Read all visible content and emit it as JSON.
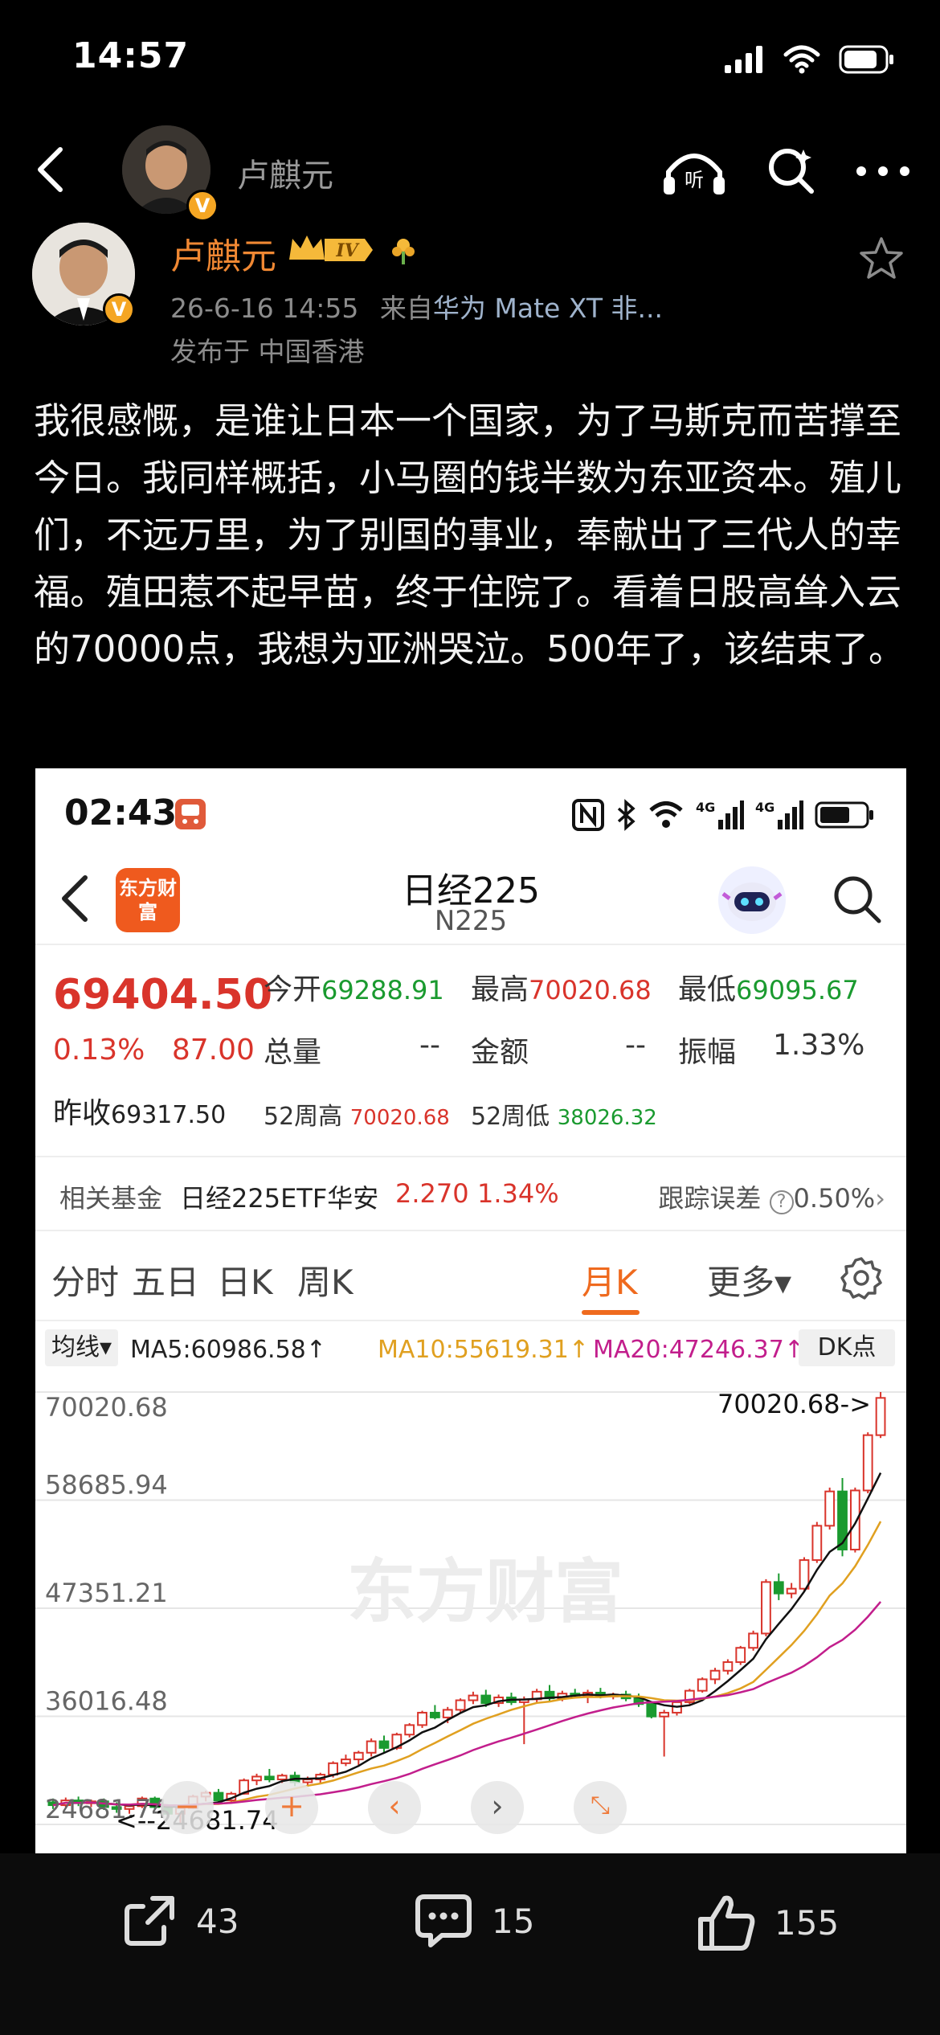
{
  "status_bar": {
    "time": "14:57"
  },
  "nav": {
    "name": "卢麒元"
  },
  "author": {
    "name": "卢麒元",
    "level": "IV",
    "timestamp": "26-6-16 14:55",
    "source_prefix": "来自",
    "device": "华为 Mate XT 非...",
    "location": "发布于 中国香港"
  },
  "post": {
    "text": "我很感慨，是谁让日本一个国家，为了马斯克而苦撑至今日。我同样概括，小马圈的钱半数为东亚资本。殖儿们，不远万里，为了别国的事业，奉献出了三代人的幸福。殖田惹不起早苗，终于住院了。看着日股高耸入云的70000点，我想为亚洲哭泣。500年了，该结束了。"
  },
  "embed": {
    "status_time": "02:43",
    "logo_text": "东方财富",
    "title": "日经225",
    "subtitle": "N225",
    "quote": {
      "price": "69404.50",
      "change_pct": "0.13%",
      "change": "87.00",
      "prev_label": "昨收",
      "prev_value": "69317.50",
      "open_label": "今开",
      "open_value": "69288.91",
      "high_label": "最高",
      "high_value": "70020.68",
      "low_label": "最低",
      "low_value": "69095.67",
      "vol_label": "总量",
      "vol_value": "--",
      "amt_label": "金额",
      "amt_value": "--",
      "amp_label": "振幅",
      "amp_value": "1.33%",
      "w52h_label": "52周高",
      "w52h_value": "70020.68",
      "w52l_label": "52周低",
      "w52l_value": "38026.32"
    },
    "fund": {
      "label": "相关基金",
      "name": "日经225ETF华安",
      "price": "2.270",
      "pct": "1.34%",
      "tracking_label": "跟踪误差",
      "tracking_value": "0.50%"
    },
    "tabs": [
      "分时",
      "五日",
      "日K",
      "周K",
      "月K",
      "更多▾"
    ],
    "ma": {
      "selector": "均线▾",
      "ma5": "MA5:60986.58↑",
      "ma10": "MA10:55619.31↑",
      "ma20": "MA20:47246.37↑",
      "dk": "DK点"
    },
    "watermark": "东方财富",
    "colors": {
      "up": "#d9342b",
      "down": "#1a9a2f",
      "ma5": "#111111",
      "ma10": "#e0a020",
      "ma20": "#c21e8c"
    }
  },
  "chart_data": {
    "type": "candlestick",
    "y_ticks": [
      "70020.68",
      "58685.94",
      "47351.21",
      "36016.48",
      "24681.74"
    ],
    "max_label": "70020.68->",
    "min_label": "<--24681.74",
    "ylim": [
      24681.74,
      70020.68
    ],
    "candles": [
      [
        27000,
        27400,
        26300,
        26700
      ],
      [
        26700,
        27500,
        26500,
        27200
      ],
      [
        27200,
        27600,
        26600,
        26900
      ],
      [
        26900,
        27300,
        26500,
        27100
      ],
      [
        27100,
        27400,
        26200,
        26500
      ],
      [
        26500,
        27000,
        25900,
        26300
      ],
      [
        26300,
        26800,
        25800,
        26600
      ],
      [
        26600,
        27600,
        26400,
        27400
      ],
      [
        27400,
        27600,
        26200,
        26500
      ],
      [
        26500,
        26800,
        25400,
        25800
      ],
      [
        25800,
        26700,
        24682,
        26400
      ],
      [
        26400,
        27800,
        26300,
        27600
      ],
      [
        27600,
        28200,
        27100,
        28000
      ],
      [
        28000,
        28400,
        27000,
        27200
      ],
      [
        27200,
        28100,
        27000,
        27900
      ],
      [
        27900,
        29500,
        27800,
        29300
      ],
      [
        29300,
        30000,
        28800,
        29700
      ],
      [
        29700,
        30500,
        29100,
        29400
      ],
      [
        29400,
        30000,
        29000,
        29800
      ],
      [
        29800,
        30200,
        28700,
        29100
      ],
      [
        29100,
        29700,
        28700,
        29400
      ],
      [
        29400,
        30100,
        29000,
        29900
      ],
      [
        29900,
        31300,
        29600,
        31100
      ],
      [
        31100,
        32000,
        30800,
        31500
      ],
      [
        31500,
        32400,
        30900,
        32200
      ],
      [
        32200,
        33700,
        31800,
        33400
      ],
      [
        33400,
        34000,
        32200,
        32700
      ],
      [
        32700,
        34300,
        32500,
        34100
      ],
      [
        34100,
        35300,
        33800,
        35100
      ],
      [
        35100,
        36600,
        34800,
        36400
      ],
      [
        36400,
        37200,
        35700,
        35900
      ],
      [
        35900,
        37000,
        35300,
        36700
      ],
      [
        36700,
        37900,
        36400,
        37700
      ],
      [
        37700,
        38600,
        37300,
        38200
      ],
      [
        38200,
        38800,
        37000,
        37400
      ],
      [
        37400,
        38300,
        37000,
        38000
      ],
      [
        38000,
        38500,
        37200,
        37500
      ],
      [
        37500,
        38100,
        33100,
        37800
      ],
      [
        37800,
        38900,
        37400,
        38600
      ],
      [
        38600,
        39300,
        37600,
        37900
      ],
      [
        37900,
        38700,
        37600,
        38400
      ],
      [
        38400,
        38900,
        37900,
        38200
      ],
      [
        38200,
        38800,
        37400,
        38500
      ],
      [
        38500,
        39000,
        37900,
        38100
      ],
      [
        38100,
        38500,
        37800,
        38300
      ],
      [
        38300,
        38700,
        37600,
        37900
      ],
      [
        37900,
        38400,
        37000,
        37300
      ],
      [
        37300,
        37600,
        35800,
        36000
      ],
      [
        36000,
        36700,
        31800,
        36400
      ],
      [
        36400,
        37700,
        36100,
        37500
      ],
      [
        37500,
        38900,
        37300,
        38700
      ],
      [
        38700,
        40100,
        38500,
        39900
      ],
      [
        39900,
        41100,
        39400,
        40800
      ],
      [
        40800,
        42000,
        40400,
        41700
      ],
      [
        41700,
        43400,
        41400,
        43200
      ],
      [
        43200,
        45000,
        42900,
        44700
      ],
      [
        44700,
        50400,
        44400,
        50100
      ],
      [
        50100,
        51000,
        48200,
        48900
      ],
      [
        48900,
        50000,
        48400,
        49400
      ],
      [
        49400,
        52700,
        49100,
        52400
      ],
      [
        52400,
        56400,
        52100,
        56000
      ],
      [
        56000,
        60000,
        55600,
        59600
      ],
      [
        59600,
        61000,
        52800,
        53500
      ],
      [
        53500,
        60000,
        53200,
        59700
      ],
      [
        59700,
        65800,
        59400,
        65500
      ],
      [
        65500,
        70021,
        65200,
        69405
      ]
    ]
  },
  "actions": {
    "share_count": "43",
    "comment_count": "15",
    "like_count": "155"
  }
}
